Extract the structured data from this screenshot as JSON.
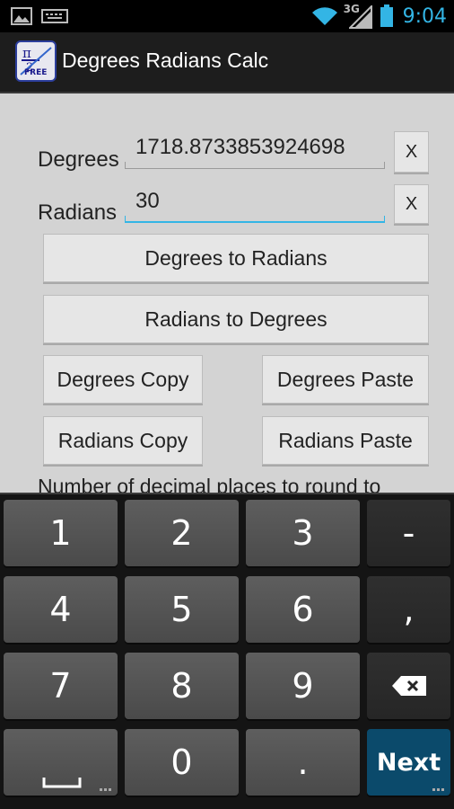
{
  "status_bar": {
    "time": "9:04",
    "network": "3G",
    "icons": [
      "image-icon",
      "keyboard-icon",
      "wifi-icon",
      "signal-icon",
      "battery-icon"
    ]
  },
  "app": {
    "title": "Degrees Radians Calc",
    "icon_label": "FREE"
  },
  "form": {
    "degrees_label": "Degrees",
    "degrees_value": "1718.8733853924698",
    "radians_label": "Radians",
    "radians_value": "30",
    "clear_label": "X"
  },
  "buttons": {
    "deg_to_rad": "Degrees to Radians",
    "rad_to_deg": "Radians to Degrees",
    "degrees_copy": "Degrees Copy",
    "degrees_paste": "Degrees Paste",
    "radians_copy": "Radians Copy",
    "radians_paste": "Radians Paste"
  },
  "round_label": "Number of decimal places to round to",
  "keyboard": {
    "keys": [
      "1",
      "2",
      "3",
      "-",
      "4",
      "5",
      "6",
      ",",
      "7",
      "8",
      "9",
      "0",
      "."
    ],
    "next_label": "Next"
  },
  "colors": {
    "accent": "#33b5e5",
    "action_bar": "#1d1d1d",
    "content_bg": "#d3d3d3",
    "next_key": "#0b4a6b"
  }
}
